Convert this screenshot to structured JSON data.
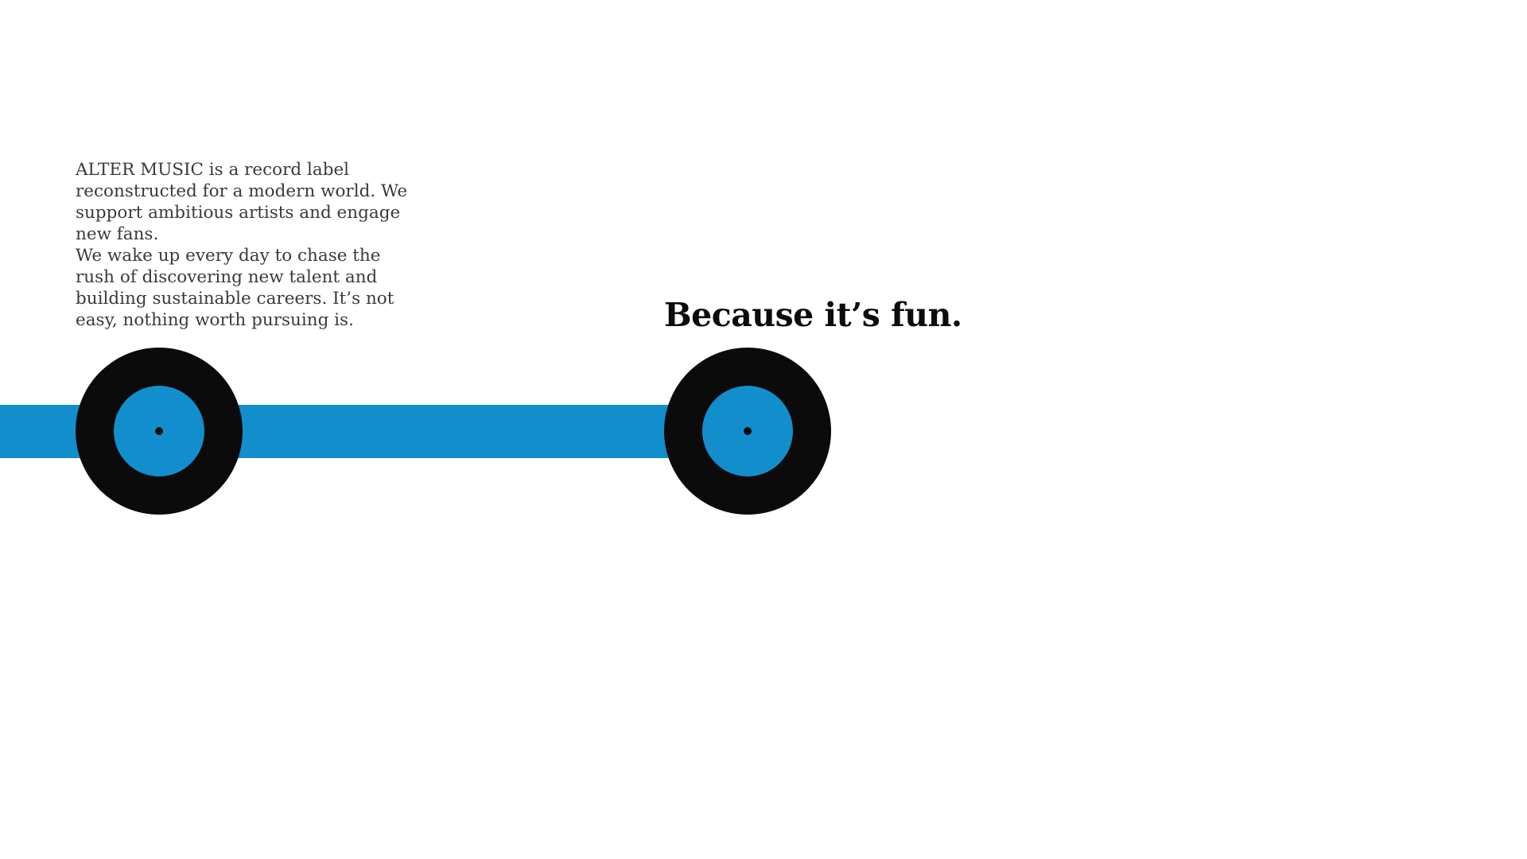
{
  "intro": {
    "paragraph_1": "ALTER MUSIC is a record label reconstructed for a modern world. We support ambitious artists and engage new fans.",
    "paragraph_2": "We wake up every day to chase the rush of discovering new talent and building sustainable careers. It’s not easy, nothing worth pursuing is."
  },
  "tagline": "Because it’s fun.",
  "colors": {
    "accent_blue": "#138ecd",
    "record_black": "#0b0b0b",
    "body_text": "#3a3a3a",
    "background": "#ffffff"
  },
  "icons": [
    "vinyl-record-icon",
    "vinyl-record-icon"
  ]
}
